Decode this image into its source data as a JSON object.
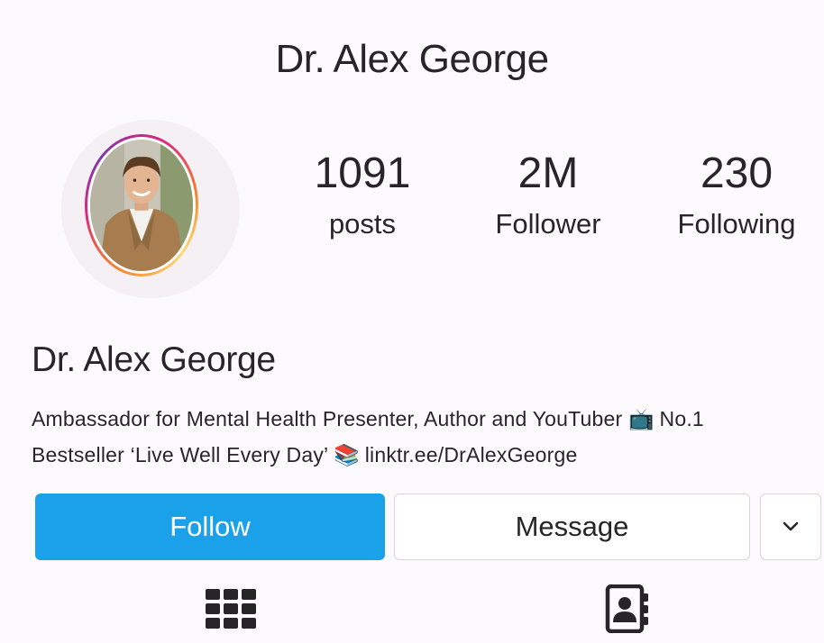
{
  "header": {
    "title": "Dr. Alex George"
  },
  "stats": {
    "posts": {
      "value": "1091",
      "label": "posts"
    },
    "followers": {
      "value": "2M",
      "label": "Follower"
    },
    "following": {
      "value": "230",
      "label": "Following"
    }
  },
  "profile": {
    "name": "Dr. Alex George",
    "bio_line1": "Ambassador for Mental Health Presenter, Author and YouTuber",
    "bio_emoji1": "📺",
    "bio_line1_end": "No.1",
    "bio_line2": "Bestseller ‘Live Well Every Day’",
    "bio_emoji2": "📚",
    "bio_link": "linktr.ee/DrAlexGeorge"
  },
  "actions": {
    "follow_label": "Follow",
    "message_label": "Message"
  },
  "colors": {
    "follow_button": "#1aa1ea",
    "story_ring": [
      "#f58529",
      "#dd2a7b",
      "#8134af"
    ],
    "text": "#262626"
  },
  "icons": {
    "more": "chevron-down-icon",
    "grid_tab": "grid-icon",
    "tagged_tab": "contact-book-icon"
  }
}
